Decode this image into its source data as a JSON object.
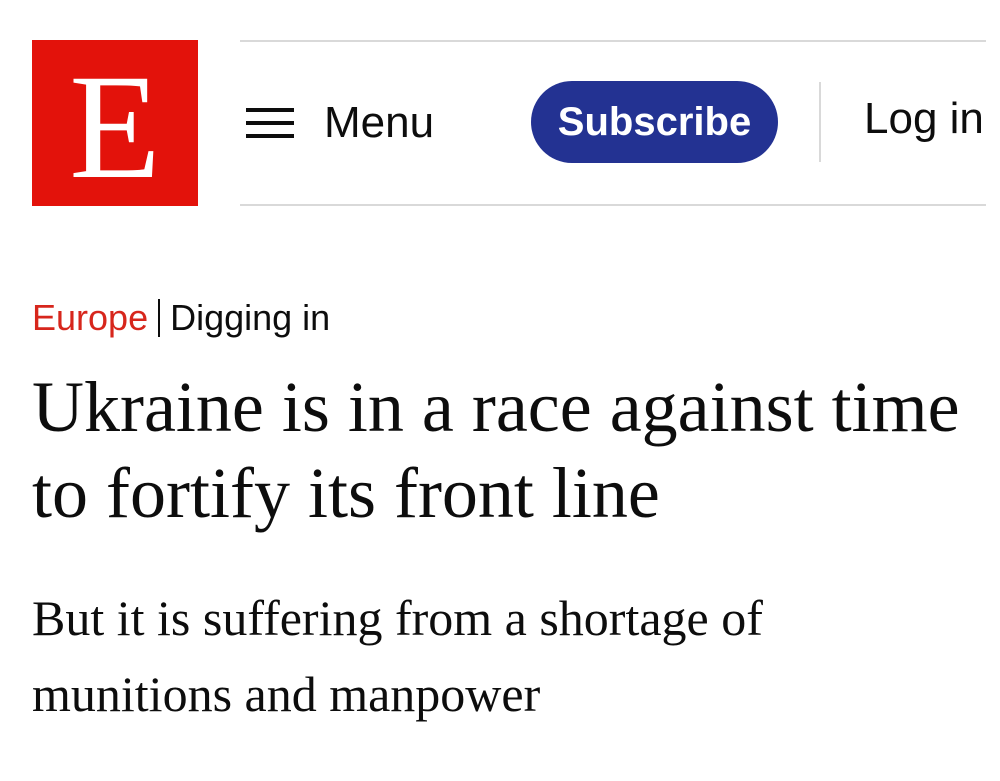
{
  "brand": {
    "logo_letter": "E",
    "logo_color": "#e3120b"
  },
  "nav": {
    "menu_icon": "hamburger-icon",
    "menu_label": "Menu",
    "subscribe_label": "Subscribe",
    "subscribe_color": "#233292",
    "login_label": "Log in"
  },
  "article": {
    "section": "Europe",
    "section_color": "#d7261c",
    "rubric": "Digging in",
    "headline": "Ukraine is in a race against time to fortify its front line",
    "subheadline": "But it is suffering from a shortage of munitions and manpower"
  }
}
